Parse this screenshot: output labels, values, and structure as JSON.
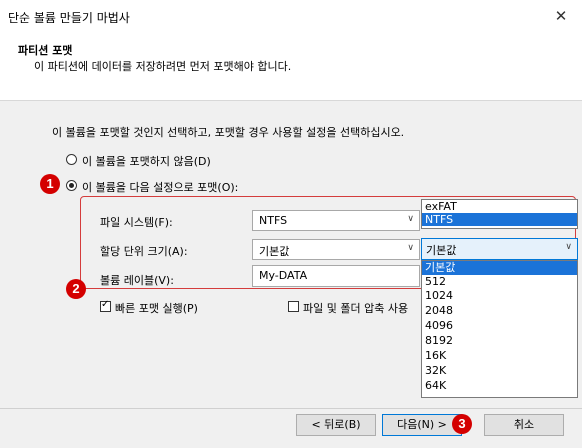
{
  "window": {
    "title": "단순 볼륨 만들기 마법사",
    "close_icon": "close-icon"
  },
  "header": {
    "title": "파티션 포맷",
    "subtitle": "이 파티션에 데이터를 저장하려면 먼저 포맷해야 합니다."
  },
  "instruction": "이 볼륨을 포맷할 것인지 선택하고, 포맷할 경우 사용할 설정을 선택하십시오.",
  "options": {
    "no_format": "이 볼륨을 포맷하지 않음(D)",
    "format_with": "이 볼륨을 다음 설정으로 포맷(O):"
  },
  "fields": {
    "fs_label": "파일 시스템(F):",
    "fs_value": "NTFS",
    "alloc_label": "할당 단위 크기(A):",
    "alloc_value": "기본값",
    "volume_label": "볼륨 레이블(V):",
    "volume_value": "My-DATA"
  },
  "fs_dropdown": [
    "exFAT",
    "NTFS"
  ],
  "fs_dropdown_selected": "NTFS",
  "alloc_dropdown_current": "기본값",
  "alloc_dropdown": [
    "기본값",
    "512",
    "1024",
    "2048",
    "4096",
    "8192",
    "16K",
    "32K",
    "64K"
  ],
  "alloc_dropdown_selected": "기본값",
  "checkboxes": {
    "quick_format": "빠른 포맷 실행(P)",
    "compress": "파일 및 폴더 압축 사용"
  },
  "buttons": {
    "back": "< 뒤로(B)",
    "next": "다음(N) >",
    "cancel": "취소"
  },
  "badges": [
    "1",
    "2",
    "3"
  ],
  "colors": {
    "badge": "#d40000",
    "selection": "#1b73d8",
    "highlight_box": "#d43c3c"
  }
}
